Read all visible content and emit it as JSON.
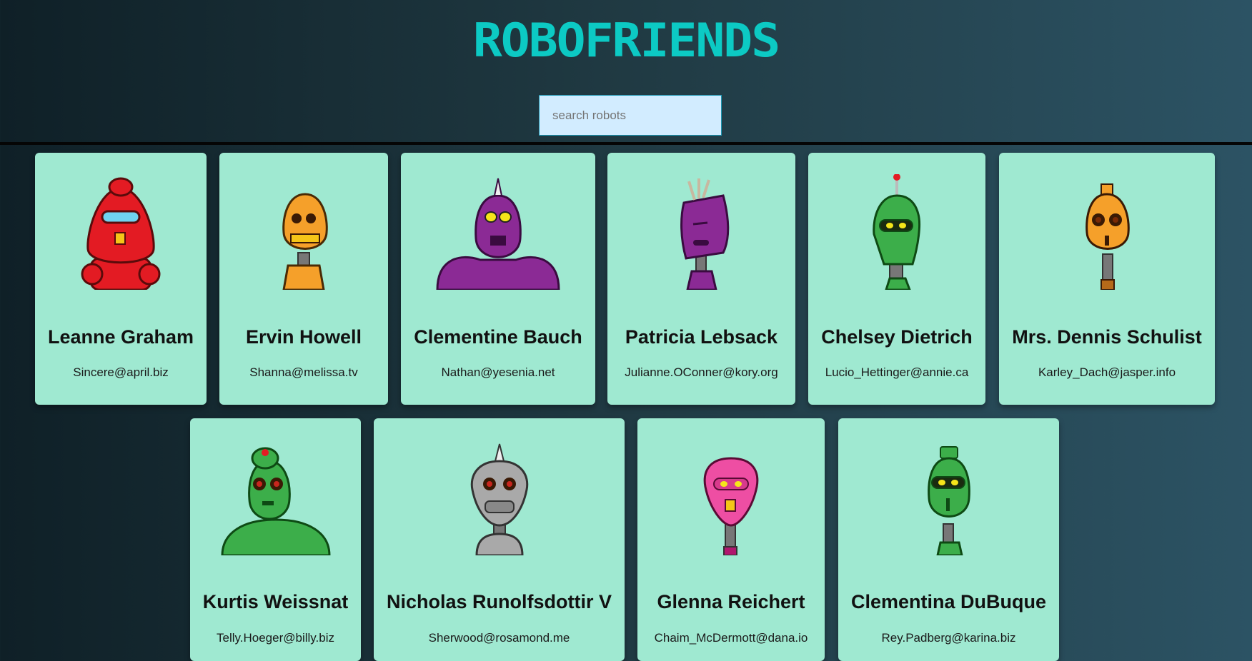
{
  "app": {
    "title": "ROBOFRIENDS"
  },
  "search": {
    "placeholder": "search robots",
    "value": ""
  },
  "robots": [
    {
      "name": "Leanne Graham",
      "email": "Sincere@april.biz",
      "color": "#e31b23"
    },
    {
      "name": "Ervin Howell",
      "email": "Shanna@melissa.tv",
      "color": "#f5a02a"
    },
    {
      "name": "Clementine Bauch",
      "email": "Nathan@yesenia.net",
      "color": "#8b2a95"
    },
    {
      "name": "Patricia Lebsack",
      "email": "Julianne.OConner@kory.org",
      "color": "#8b2a95"
    },
    {
      "name": "Chelsey Dietrich",
      "email": "Lucio_Hettinger@annie.ca",
      "color": "#3cae4a"
    },
    {
      "name": "Mrs. Dennis Schulist",
      "email": "Karley_Dach@jasper.info",
      "color": "#f5a02a"
    },
    {
      "name": "Kurtis Weissnat",
      "email": "Telly.Hoeger@billy.biz",
      "color": "#3cae4a"
    },
    {
      "name": "Nicholas Runolfsdottir V",
      "email": "Sherwood@rosamond.me",
      "color": "#a9a9a9"
    },
    {
      "name": "Glenna Reichert",
      "email": "Chaim_McDermott@dana.io",
      "color": "#ee4ea3"
    },
    {
      "name": "Clementina DuBuque",
      "email": "Rey.Padberg@karina.biz",
      "color": "#3cae4a"
    }
  ]
}
